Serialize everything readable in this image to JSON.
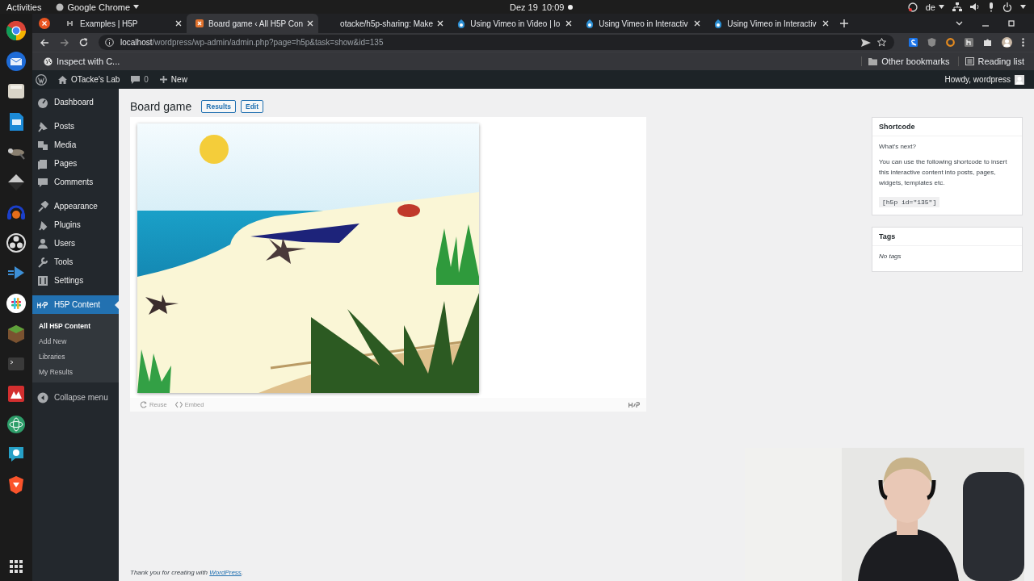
{
  "top_bar": {
    "activities": "Activities",
    "app_menu": "Google Chrome",
    "date": "Dez 19",
    "time": "10:09",
    "keyboard_layout": "de"
  },
  "tabs": [
    {
      "title": "Examples | H5P",
      "selected": false
    },
    {
      "title": "Board game ‹ All H5P Con",
      "selected": true
    },
    {
      "title": "otacke/h5p-sharing: Make",
      "selected": false
    },
    {
      "title": "Using Vimeo in Video | lo",
      "selected": false
    },
    {
      "title": "Using Vimeo in Interactiv",
      "selected": false
    },
    {
      "title": "Using Vimeo in Interactiv",
      "selected": false
    }
  ],
  "address_bar": {
    "host": "localhost",
    "path": "/wordpress/wp-admin/admin.php?page=h5p&task=show&id=135"
  },
  "bookmarks": {
    "items": [
      "Inspect with C..."
    ],
    "other": "Other bookmarks",
    "reading_list": "Reading list"
  },
  "admin_bar": {
    "site_name": "OTacke's Lab",
    "comments": "0",
    "new": "New",
    "greeting": "Howdy, wordpress"
  },
  "menu_groups": [
    {
      "items": [
        {
          "label": "Dashboard",
          "selected": false
        }
      ]
    },
    {
      "items": [
        {
          "label": "Posts",
          "selected": false
        },
        {
          "label": "Media",
          "selected": false
        },
        {
          "label": "Pages",
          "selected": false
        },
        {
          "label": "Comments",
          "selected": false
        }
      ]
    },
    {
      "items": [
        {
          "label": "Appearance",
          "selected": false
        },
        {
          "label": "Plugins",
          "selected": false
        },
        {
          "label": "Users",
          "selected": false
        },
        {
          "label": "Tools",
          "selected": false
        },
        {
          "label": "Settings",
          "selected": false
        }
      ]
    },
    {
      "items": [
        {
          "label": "H5P Content",
          "selected": true
        }
      ]
    }
  ],
  "submenu": [
    {
      "label": "All H5P Content",
      "selected": true
    },
    {
      "label": "Add New",
      "selected": false
    },
    {
      "label": "Libraries",
      "selected": false
    },
    {
      "label": "My Results",
      "selected": false
    }
  ],
  "collapse_menu": "Collapse menu",
  "page": {
    "title": "Board game",
    "buttons": [
      "Results",
      "Edit"
    ],
    "actions": [
      "Reuse",
      "Embed"
    ]
  },
  "shortcode_box": {
    "title": "Shortcode",
    "lead": "What's next?",
    "text": "You can use the following shortcode to insert this interactive content into posts, pages, widgets, templates etc.",
    "code": "[h5p id=\"135\"]"
  },
  "tags_box": {
    "title": "Tags",
    "empty": "No tags"
  },
  "footer": {
    "text": "Thank you for creating with",
    "link": "WordPress",
    "end": "."
  }
}
